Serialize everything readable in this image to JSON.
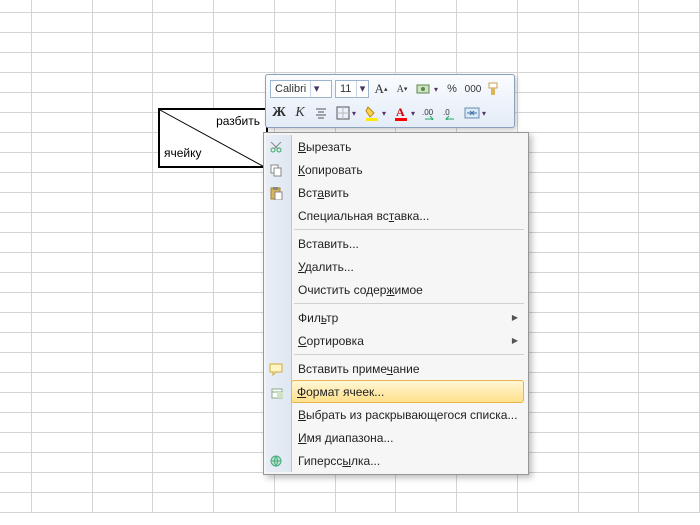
{
  "cell": {
    "top": "разбить",
    "bottom": "ячейку"
  },
  "toolbar": {
    "font_name": "Calibri",
    "font_size": "11",
    "grow_font": "A",
    "shrink_font": "A",
    "percent": "%",
    "zeros": "000",
    "bold": "Ж",
    "italic": "К"
  },
  "menu": {
    "cut": "Вырезать",
    "copy": "Копировать",
    "paste": "Вставить",
    "paste_special": "Специальная вставка...",
    "insert": "Вставить...",
    "delete": "Удалить...",
    "clear": "Очистить содержимое",
    "filter": "Фильтр",
    "sort": "Сортировка",
    "comment": "Вставить примечание",
    "format": "Формат ячеек...",
    "picklist": "Выбрать из раскрывающегося списка...",
    "name_range": "Имя диапазона...",
    "hyperlink": "Гиперссылка..."
  }
}
